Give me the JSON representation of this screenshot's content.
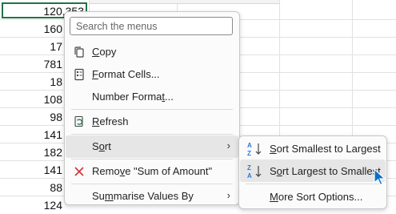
{
  "grid": {
    "cells": [
      "120,353",
      "160",
      "17",
      "781",
      "18",
      "108",
      "98",
      "141",
      "182",
      "141",
      "88",
      "124"
    ]
  },
  "menu": {
    "search_placeholder": "Search the menus",
    "items": [
      {
        "label": "Copy",
        "underline": "C",
        "rest": "opy",
        "icon": "copy-icon"
      },
      {
        "label": "Format Cells...",
        "underline": "F",
        "rest": "ormat Cells...",
        "icon": "format-cells-icon"
      },
      {
        "label": "Number Format...",
        "pre": "Number Forma",
        "underline": "t",
        "rest": "...",
        "icon": ""
      },
      {
        "label": "Refresh",
        "underline": "R",
        "rest": "efresh",
        "icon": "refresh-icon"
      },
      {
        "label": "Sort",
        "pre": "S",
        "underline": "o",
        "rest": "rt",
        "icon": "",
        "has_submenu": true
      },
      {
        "label": "Remove \"Sum of Amount\"",
        "pre": "Remo",
        "underline": "v",
        "rest": "e \"Sum of Amount\"",
        "icon": "remove-x-icon"
      },
      {
        "label": "Summarise Values By",
        "pre": "Su",
        "underline": "m",
        "rest": "marise Values By",
        "icon": "",
        "has_submenu": true
      }
    ]
  },
  "submenu": {
    "items": [
      {
        "label": "Sort Smallest to Largest",
        "underline": "S",
        "rest": "ort Smallest to Largest",
        "icon": "sort-ascending-icon",
        "icon_top": "A",
        "icon_bottom": "Z"
      },
      {
        "label": "Sort Largest to Smallest",
        "pre": "S",
        "underline": "o",
        "rest": "rt Largest to Smallest",
        "icon": "sort-descending-icon",
        "icon_top": "Z",
        "icon_bottom": "A"
      },
      {
        "label": "More Sort Options...",
        "underline": "M",
        "rest": "ore Sort Options...",
        "icon": ""
      }
    ]
  },
  "colors": {
    "accent_green": "#217346",
    "sort_icon_blue": "#2a7ad6",
    "remove_red": "#d13438",
    "refresh_green": "#2e8b57",
    "cursor_blue": "#0b6fc9"
  }
}
